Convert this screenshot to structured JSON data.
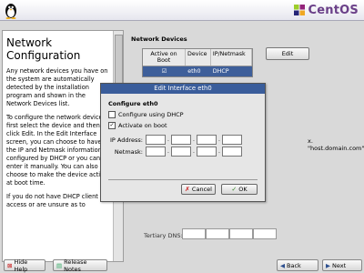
{
  "header": {
    "brand": "CentOS"
  },
  "help": {
    "title": "Network Configuration",
    "paragraphs": [
      "Any network devices you have on the system are automatically detected by the installation program and shown in the Network Devices list.",
      "To configure the network device, first select the device and then click Edit. In the Edit Interface screen, you can choose to have the IP and Netmask information configured by DHCP or you can enter it manually. You can also choose to make the device active at boot time.",
      "If you do not have DHCP client access or are unsure as to"
    ]
  },
  "main": {
    "devices_label": "Network Devices",
    "table": {
      "headers": [
        "Active on Boot",
        "Device",
        "IP/Netmask"
      ],
      "rows": [
        {
          "active": "☑",
          "device": "eth0",
          "ip": "DHCP"
        }
      ]
    },
    "edit_button": "Edit",
    "hostname_hint": "x. \"host.domain.com\")",
    "tertiary_dns": "Tertiary DNS:"
  },
  "dialog": {
    "title": "Edit Interface eth0",
    "config_label": "Configure eth0",
    "dhcp_label": "Configure using DHCP",
    "dhcp_checked": "",
    "boot_label": "Activate on boot",
    "boot_checked": "✓",
    "ip_label": "IP Address:",
    "netmask_label": "Netmask:",
    "dot": ".",
    "cancel": "Cancel",
    "ok": "OK"
  },
  "bottom": {
    "hide_help": "Hide Help",
    "release_notes": "Release Notes",
    "back": "Back",
    "next": "Next"
  },
  "colors": {
    "selection": "#3e5f9a",
    "title_bar": "#3a5d9b",
    "brand": "#6a3f88"
  }
}
